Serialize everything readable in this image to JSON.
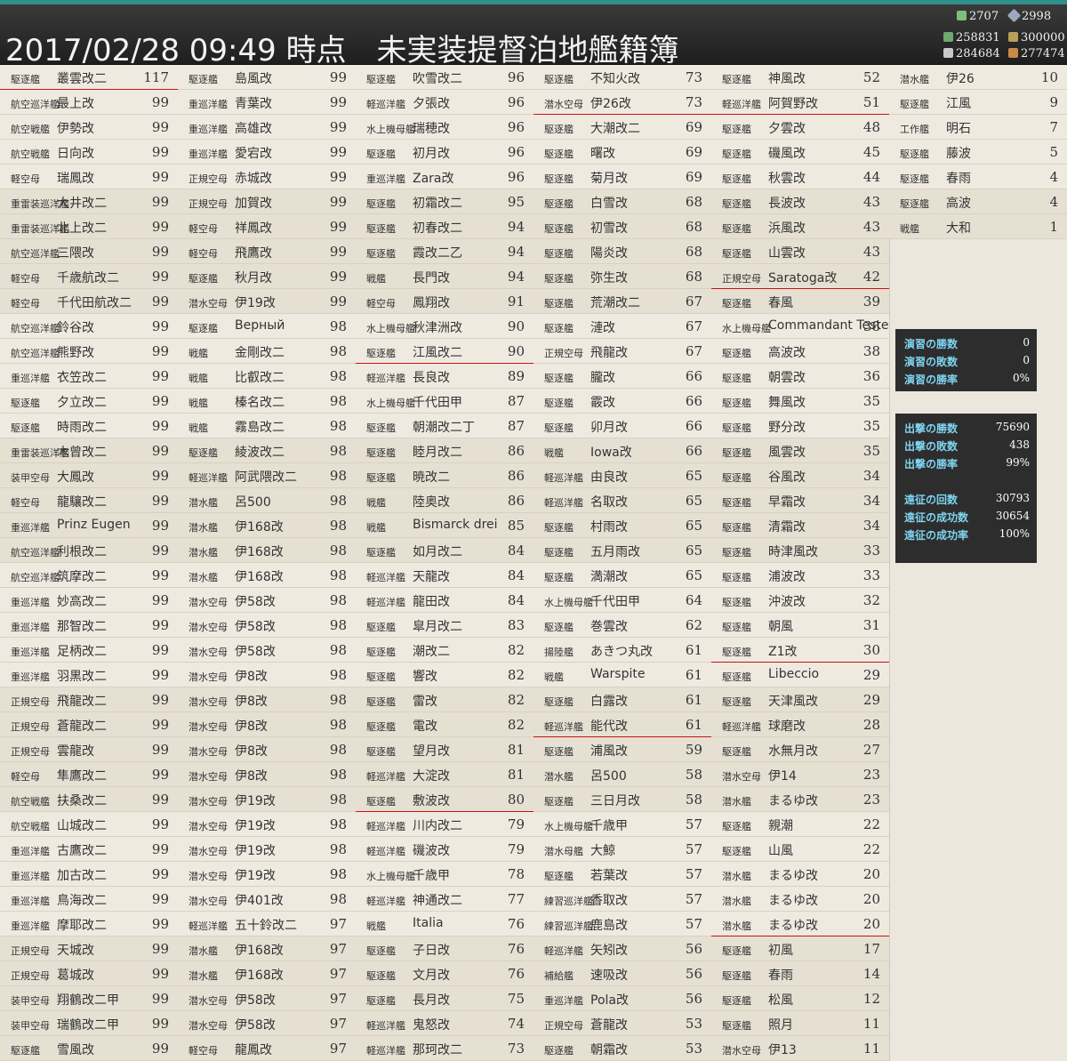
{
  "header": {
    "title": "2017/02/28 09:49 時点　未実装提督泊地艦籍簿",
    "resources": {
      "bucket": "2707",
      "devmat": "2998",
      "fuel": "258831",
      "ammo": "300000",
      "steel": "284684",
      "bauxite": "277474"
    }
  },
  "columns": [
    [
      {
        "type": "駆逐艦",
        "name": "叢雲改二",
        "lv": "117",
        "mark": true
      },
      {
        "type": "航空巡洋艦",
        "name": "最上改",
        "lv": "99"
      },
      {
        "type": "航空戦艦",
        "name": "伊勢改",
        "lv": "99"
      },
      {
        "type": "航空戦艦",
        "name": "日向改",
        "lv": "99"
      },
      {
        "type": "軽空母",
        "name": "瑞鳳改",
        "lv": "99"
      },
      {
        "type": "重雷装巡洋艦",
        "name": "大井改二",
        "lv": "99"
      },
      {
        "type": "重雷装巡洋艦",
        "name": "北上改二",
        "lv": "99"
      },
      {
        "type": "航空巡洋艦",
        "name": "三隈改",
        "lv": "99"
      },
      {
        "type": "軽空母",
        "name": "千歳航改二",
        "lv": "99"
      },
      {
        "type": "軽空母",
        "name": "千代田航改二",
        "lv": "99"
      },
      {
        "type": "航空巡洋艦",
        "name": "鈴谷改",
        "lv": "99"
      },
      {
        "type": "航空巡洋艦",
        "name": "熊野改",
        "lv": "99"
      },
      {
        "type": "重巡洋艦",
        "name": "衣笠改二",
        "lv": "99"
      },
      {
        "type": "駆逐艦",
        "name": "夕立改二",
        "lv": "99"
      },
      {
        "type": "駆逐艦",
        "name": "時雨改二",
        "lv": "99"
      },
      {
        "type": "重雷装巡洋艦",
        "name": "木曾改二",
        "lv": "99"
      },
      {
        "type": "装甲空母",
        "name": "大鳳改",
        "lv": "99"
      },
      {
        "type": "軽空母",
        "name": "龍驤改二",
        "lv": "99"
      },
      {
        "type": "重巡洋艦",
        "name": "Prinz Eugen",
        "lv": "99"
      },
      {
        "type": "航空巡洋艦",
        "name": "利根改二",
        "lv": "99"
      },
      {
        "type": "航空巡洋艦",
        "name": "筑摩改二",
        "lv": "99"
      },
      {
        "type": "重巡洋艦",
        "name": "妙高改二",
        "lv": "99"
      },
      {
        "type": "重巡洋艦",
        "name": "那智改二",
        "lv": "99"
      },
      {
        "type": "重巡洋艦",
        "name": "足柄改二",
        "lv": "99"
      },
      {
        "type": "重巡洋艦",
        "name": "羽黒改二",
        "lv": "99"
      },
      {
        "type": "正規空母",
        "name": "飛龍改二",
        "lv": "99"
      },
      {
        "type": "正規空母",
        "name": "蒼龍改二",
        "lv": "99"
      },
      {
        "type": "正規空母",
        "name": "雲龍改",
        "lv": "99"
      },
      {
        "type": "軽空母",
        "name": "隼鷹改二",
        "lv": "99"
      },
      {
        "type": "航空戦艦",
        "name": "扶桑改二",
        "lv": "99"
      },
      {
        "type": "航空戦艦",
        "name": "山城改二",
        "lv": "99"
      },
      {
        "type": "重巡洋艦",
        "name": "古鷹改二",
        "lv": "99"
      },
      {
        "type": "重巡洋艦",
        "name": "加古改二",
        "lv": "99"
      },
      {
        "type": "重巡洋艦",
        "name": "鳥海改二",
        "lv": "99"
      },
      {
        "type": "重巡洋艦",
        "name": "摩耶改二",
        "lv": "99"
      },
      {
        "type": "正規空母",
        "name": "天城改",
        "lv": "99"
      },
      {
        "type": "正規空母",
        "name": "葛城改",
        "lv": "99"
      },
      {
        "type": "装甲空母",
        "name": "翔鶴改二甲",
        "lv": "99"
      },
      {
        "type": "装甲空母",
        "name": "瑞鶴改二甲",
        "lv": "99"
      },
      {
        "type": "駆逐艦",
        "name": "雪風改",
        "lv": "99"
      }
    ],
    [
      {
        "type": "駆逐艦",
        "name": "島風改",
        "lv": "99"
      },
      {
        "type": "重巡洋艦",
        "name": "青葉改",
        "lv": "99"
      },
      {
        "type": "重巡洋艦",
        "name": "高雄改",
        "lv": "99"
      },
      {
        "type": "重巡洋艦",
        "name": "愛宕改",
        "lv": "99"
      },
      {
        "type": "正規空母",
        "name": "赤城改",
        "lv": "99"
      },
      {
        "type": "正規空母",
        "name": "加賀改",
        "lv": "99"
      },
      {
        "type": "軽空母",
        "name": "祥鳳改",
        "lv": "99"
      },
      {
        "type": "軽空母",
        "name": "飛鷹改",
        "lv": "99"
      },
      {
        "type": "駆逐艦",
        "name": "秋月改",
        "lv": "99"
      },
      {
        "type": "潜水空母",
        "name": "伊19改",
        "lv": "99"
      },
      {
        "type": "駆逐艦",
        "name": "Верный",
        "lv": "98"
      },
      {
        "type": "戦艦",
        "name": "金剛改二",
        "lv": "98"
      },
      {
        "type": "戦艦",
        "name": "比叡改二",
        "lv": "98"
      },
      {
        "type": "戦艦",
        "name": "榛名改二",
        "lv": "98"
      },
      {
        "type": "戦艦",
        "name": "霧島改二",
        "lv": "98"
      },
      {
        "type": "駆逐艦",
        "name": "綾波改二",
        "lv": "98"
      },
      {
        "type": "軽巡洋艦",
        "name": "阿武隈改二",
        "lv": "98"
      },
      {
        "type": "潜水艦",
        "name": "呂500",
        "lv": "98"
      },
      {
        "type": "潜水艦",
        "name": "伊168改",
        "lv": "98"
      },
      {
        "type": "潜水艦",
        "name": "伊168改",
        "lv": "98"
      },
      {
        "type": "潜水艦",
        "name": "伊168改",
        "lv": "98"
      },
      {
        "type": "潜水空母",
        "name": "伊58改",
        "lv": "98"
      },
      {
        "type": "潜水空母",
        "name": "伊58改",
        "lv": "98"
      },
      {
        "type": "潜水空母",
        "name": "伊58改",
        "lv": "98"
      },
      {
        "type": "潜水空母",
        "name": "伊8改",
        "lv": "98"
      },
      {
        "type": "潜水空母",
        "name": "伊8改",
        "lv": "98"
      },
      {
        "type": "潜水空母",
        "name": "伊8改",
        "lv": "98"
      },
      {
        "type": "潜水空母",
        "name": "伊8改",
        "lv": "98"
      },
      {
        "type": "潜水空母",
        "name": "伊8改",
        "lv": "98"
      },
      {
        "type": "潜水空母",
        "name": "伊19改",
        "lv": "98"
      },
      {
        "type": "潜水空母",
        "name": "伊19改",
        "lv": "98"
      },
      {
        "type": "潜水空母",
        "name": "伊19改",
        "lv": "98"
      },
      {
        "type": "潜水空母",
        "name": "伊19改",
        "lv": "98"
      },
      {
        "type": "潜水空母",
        "name": "伊401改",
        "lv": "98"
      },
      {
        "type": "軽巡洋艦",
        "name": "五十鈴改二",
        "lv": "97"
      },
      {
        "type": "潜水艦",
        "name": "伊168改",
        "lv": "97"
      },
      {
        "type": "潜水艦",
        "name": "伊168改",
        "lv": "97"
      },
      {
        "type": "潜水空母",
        "name": "伊58改",
        "lv": "97"
      },
      {
        "type": "潜水空母",
        "name": "伊58改",
        "lv": "97"
      },
      {
        "type": "軽空母",
        "name": "龍鳳改",
        "lv": "97"
      }
    ],
    [
      {
        "type": "駆逐艦",
        "name": "吹雪改二",
        "lv": "96"
      },
      {
        "type": "軽巡洋艦",
        "name": "夕張改",
        "lv": "96"
      },
      {
        "type": "水上機母艦",
        "name": "瑞穂改",
        "lv": "96"
      },
      {
        "type": "駆逐艦",
        "name": "初月改",
        "lv": "96"
      },
      {
        "type": "重巡洋艦",
        "name": "Zara改",
        "lv": "96"
      },
      {
        "type": "駆逐艦",
        "name": "初霜改二",
        "lv": "95"
      },
      {
        "type": "駆逐艦",
        "name": "初春改二",
        "lv": "94"
      },
      {
        "type": "駆逐艦",
        "name": "霞改二乙",
        "lv": "94"
      },
      {
        "type": "戦艦",
        "name": "長門改",
        "lv": "94"
      },
      {
        "type": "軽空母",
        "name": "鳳翔改",
        "lv": "91"
      },
      {
        "type": "水上機母艦",
        "name": "秋津洲改",
        "lv": "90"
      },
      {
        "type": "駆逐艦",
        "name": "江風改二",
        "lv": "90",
        "mark": true
      },
      {
        "type": "軽巡洋艦",
        "name": "長良改",
        "lv": "89"
      },
      {
        "type": "水上機母艦",
        "name": "千代田甲",
        "lv": "87"
      },
      {
        "type": "駆逐艦",
        "name": "朝潮改二丁",
        "lv": "87"
      },
      {
        "type": "駆逐艦",
        "name": "睦月改二",
        "lv": "86"
      },
      {
        "type": "駆逐艦",
        "name": "暁改二",
        "lv": "86"
      },
      {
        "type": "戦艦",
        "name": "陸奥改",
        "lv": "86"
      },
      {
        "type": "戦艦",
        "name": "Bismarck drei",
        "lv": "85"
      },
      {
        "type": "駆逐艦",
        "name": "如月改二",
        "lv": "84"
      },
      {
        "type": "軽巡洋艦",
        "name": "天龍改",
        "lv": "84"
      },
      {
        "type": "軽巡洋艦",
        "name": "龍田改",
        "lv": "84"
      },
      {
        "type": "駆逐艦",
        "name": "皐月改二",
        "lv": "83"
      },
      {
        "type": "駆逐艦",
        "name": "潮改二",
        "lv": "82"
      },
      {
        "type": "駆逐艦",
        "name": "響改",
        "lv": "82"
      },
      {
        "type": "駆逐艦",
        "name": "雷改",
        "lv": "82"
      },
      {
        "type": "駆逐艦",
        "name": "電改",
        "lv": "82"
      },
      {
        "type": "駆逐艦",
        "name": "望月改",
        "lv": "81"
      },
      {
        "type": "軽巡洋艦",
        "name": "大淀改",
        "lv": "81"
      },
      {
        "type": "駆逐艦",
        "name": "敷波改",
        "lv": "80",
        "mark": true
      },
      {
        "type": "軽巡洋艦",
        "name": "川内改二",
        "lv": "79"
      },
      {
        "type": "軽巡洋艦",
        "name": "磯波改",
        "lv": "79"
      },
      {
        "type": "水上機母艦",
        "name": "千歳甲",
        "lv": "78"
      },
      {
        "type": "軽巡洋艦",
        "name": "神通改二",
        "lv": "77"
      },
      {
        "type": "戦艦",
        "name": "Italia",
        "lv": "76"
      },
      {
        "type": "駆逐艦",
        "name": "子日改",
        "lv": "76"
      },
      {
        "type": "駆逐艦",
        "name": "文月改",
        "lv": "76"
      },
      {
        "type": "駆逐艦",
        "name": "長月改",
        "lv": "75"
      },
      {
        "type": "軽巡洋艦",
        "name": "鬼怒改",
        "lv": "74"
      },
      {
        "type": "軽巡洋艦",
        "name": "那珂改二",
        "lv": "73"
      }
    ],
    [
      {
        "type": "駆逐艦",
        "name": "不知火改",
        "lv": "73"
      },
      {
        "type": "潜水空母",
        "name": "伊26改",
        "lv": "73",
        "mark": true
      },
      {
        "type": "駆逐艦",
        "name": "大潮改二",
        "lv": "69"
      },
      {
        "type": "駆逐艦",
        "name": "曙改",
        "lv": "69"
      },
      {
        "type": "駆逐艦",
        "name": "菊月改",
        "lv": "69"
      },
      {
        "type": "駆逐艦",
        "name": "白雪改",
        "lv": "68"
      },
      {
        "type": "駆逐艦",
        "name": "初雪改",
        "lv": "68"
      },
      {
        "type": "駆逐艦",
        "name": "陽炎改",
        "lv": "68"
      },
      {
        "type": "駆逐艦",
        "name": "弥生改",
        "lv": "68"
      },
      {
        "type": "駆逐艦",
        "name": "荒潮改二",
        "lv": "67"
      },
      {
        "type": "駆逐艦",
        "name": "漣改",
        "lv": "67"
      },
      {
        "type": "正規空母",
        "name": "飛龍改",
        "lv": "67"
      },
      {
        "type": "駆逐艦",
        "name": "朧改",
        "lv": "66"
      },
      {
        "type": "駆逐艦",
        "name": "霰改",
        "lv": "66"
      },
      {
        "type": "駆逐艦",
        "name": "卯月改",
        "lv": "66"
      },
      {
        "type": "戦艦",
        "name": "Iowa改",
        "lv": "66"
      },
      {
        "type": "軽巡洋艦",
        "name": "由良改",
        "lv": "65"
      },
      {
        "type": "軽巡洋艦",
        "name": "名取改",
        "lv": "65"
      },
      {
        "type": "駆逐艦",
        "name": "村雨改",
        "lv": "65"
      },
      {
        "type": "駆逐艦",
        "name": "五月雨改",
        "lv": "65"
      },
      {
        "type": "駆逐艦",
        "name": "満潮改",
        "lv": "65"
      },
      {
        "type": "水上機母艦",
        "name": "千代田甲",
        "lv": "64"
      },
      {
        "type": "駆逐艦",
        "name": "巻雲改",
        "lv": "62"
      },
      {
        "type": "揚陸艦",
        "name": "あきつ丸改",
        "lv": "61"
      },
      {
        "type": "戦艦",
        "name": "Warspite",
        "lv": "61"
      },
      {
        "type": "駆逐艦",
        "name": "白露改",
        "lv": "61"
      },
      {
        "type": "軽巡洋艦",
        "name": "能代改",
        "lv": "61",
        "mark": true
      },
      {
        "type": "駆逐艦",
        "name": "浦風改",
        "lv": "59"
      },
      {
        "type": "潜水艦",
        "name": "呂500",
        "lv": "58"
      },
      {
        "type": "駆逐艦",
        "name": "三日月改",
        "lv": "58"
      },
      {
        "type": "水上機母艦",
        "name": "千歳甲",
        "lv": "57"
      },
      {
        "type": "潜水母艦",
        "name": "大鯨",
        "lv": "57"
      },
      {
        "type": "駆逐艦",
        "name": "若葉改",
        "lv": "57"
      },
      {
        "type": "練習巡洋艦",
        "name": "香取改",
        "lv": "57"
      },
      {
        "type": "練習巡洋艦",
        "name": "鹿島改",
        "lv": "57"
      },
      {
        "type": "軽巡洋艦",
        "name": "矢矧改",
        "lv": "56"
      },
      {
        "type": "補給艦",
        "name": "速吸改",
        "lv": "56"
      },
      {
        "type": "重巡洋艦",
        "name": "Pola改",
        "lv": "56"
      },
      {
        "type": "正規空母",
        "name": "蒼龍改",
        "lv": "53"
      },
      {
        "type": "駆逐艦",
        "name": "朝霜改",
        "lv": "53"
      }
    ],
    [
      {
        "type": "駆逐艦",
        "name": "神風改",
        "lv": "52"
      },
      {
        "type": "軽巡洋艦",
        "name": "阿賀野改",
        "lv": "51",
        "mark": true
      },
      {
        "type": "駆逐艦",
        "name": "夕雲改",
        "lv": "48"
      },
      {
        "type": "駆逐艦",
        "name": "磯風改",
        "lv": "45"
      },
      {
        "type": "駆逐艦",
        "name": "秋雲改",
        "lv": "44"
      },
      {
        "type": "駆逐艦",
        "name": "長波改",
        "lv": "43"
      },
      {
        "type": "駆逐艦",
        "name": "浜風改",
        "lv": "43"
      },
      {
        "type": "駆逐艦",
        "name": "山雲改",
        "lv": "43"
      },
      {
        "type": "正規空母",
        "name": "Saratoga改",
        "lv": "42",
        "mark": true
      },
      {
        "type": "駆逐艦",
        "name": "春風",
        "lv": "39"
      },
      {
        "type": "水上機母艦",
        "name": "Commandant Teste",
        "lv": "38"
      },
      {
        "type": "駆逐艦",
        "name": "高波改",
        "lv": "38"
      },
      {
        "type": "駆逐艦",
        "name": "朝雲改",
        "lv": "36"
      },
      {
        "type": "駆逐艦",
        "name": "舞風改",
        "lv": "35"
      },
      {
        "type": "駆逐艦",
        "name": "野分改",
        "lv": "35"
      },
      {
        "type": "駆逐艦",
        "name": "風雲改",
        "lv": "35"
      },
      {
        "type": "駆逐艦",
        "name": "谷風改",
        "lv": "34"
      },
      {
        "type": "駆逐艦",
        "name": "早霜改",
        "lv": "34"
      },
      {
        "type": "駆逐艦",
        "name": "清霜改",
        "lv": "34"
      },
      {
        "type": "駆逐艦",
        "name": "時津風改",
        "lv": "33"
      },
      {
        "type": "駆逐艦",
        "name": "浦波改",
        "lv": "33"
      },
      {
        "type": "駆逐艦",
        "name": "沖波改",
        "lv": "32"
      },
      {
        "type": "駆逐艦",
        "name": "朝風",
        "lv": "31"
      },
      {
        "type": "駆逐艦",
        "name": "Z1改",
        "lv": "30",
        "mark": true
      },
      {
        "type": "駆逐艦",
        "name": "Libeccio",
        "lv": "29"
      },
      {
        "type": "駆逐艦",
        "name": "天津風改",
        "lv": "29"
      },
      {
        "type": "軽巡洋艦",
        "name": "球磨改",
        "lv": "28"
      },
      {
        "type": "駆逐艦",
        "name": "水無月改",
        "lv": "27"
      },
      {
        "type": "潜水空母",
        "name": "伊14",
        "lv": "23"
      },
      {
        "type": "潜水艦",
        "name": "まるゆ改",
        "lv": "23"
      },
      {
        "type": "駆逐艦",
        "name": "親潮",
        "lv": "22"
      },
      {
        "type": "駆逐艦",
        "name": "山風",
        "lv": "22"
      },
      {
        "type": "潜水艦",
        "name": "まるゆ改",
        "lv": "20"
      },
      {
        "type": "潜水艦",
        "name": "まるゆ改",
        "lv": "20"
      },
      {
        "type": "潜水艦",
        "name": "まるゆ改",
        "lv": "20",
        "mark": true
      },
      {
        "type": "駆逐艦",
        "name": "初風",
        "lv": "17"
      },
      {
        "type": "駆逐艦",
        "name": "春雨",
        "lv": "14"
      },
      {
        "type": "駆逐艦",
        "name": "松風",
        "lv": "12"
      },
      {
        "type": "駆逐艦",
        "name": "照月",
        "lv": "11"
      },
      {
        "type": "潜水空母",
        "name": "伊13",
        "lv": "11"
      }
    ],
    [
      {
        "type": "潜水艦",
        "name": "伊26",
        "lv": "10"
      },
      {
        "type": "駆逐艦",
        "name": "江風",
        "lv": "9"
      },
      {
        "type": "工作艦",
        "name": "明石",
        "lv": "7"
      },
      {
        "type": "駆逐艦",
        "name": "藤波",
        "lv": "5"
      },
      {
        "type": "駆逐艦",
        "name": "春雨",
        "lv": "4"
      },
      {
        "type": "駆逐艦",
        "name": "高波",
        "lv": "4"
      },
      {
        "type": "戦艦",
        "name": "大和",
        "lv": "1"
      }
    ]
  ],
  "stats": {
    "exercise": [
      {
        "label": "演習の勝数",
        "value": "0"
      },
      {
        "label": "演習の敗数",
        "value": "0"
      },
      {
        "label": "演習の勝率",
        "value": "0%"
      }
    ],
    "sortie": [
      {
        "label": "出撃の勝数",
        "value": "75690"
      },
      {
        "label": "出撃の敗数",
        "value": "438"
      },
      {
        "label": "出撃の勝率",
        "value": "99%"
      }
    ],
    "expedition": [
      {
        "label": "遠征の回数",
        "value": "30793"
      },
      {
        "label": "遠征の成功数",
        "value": "30654"
      },
      {
        "label": "遠征の成功率",
        "value": "100%"
      }
    ]
  }
}
